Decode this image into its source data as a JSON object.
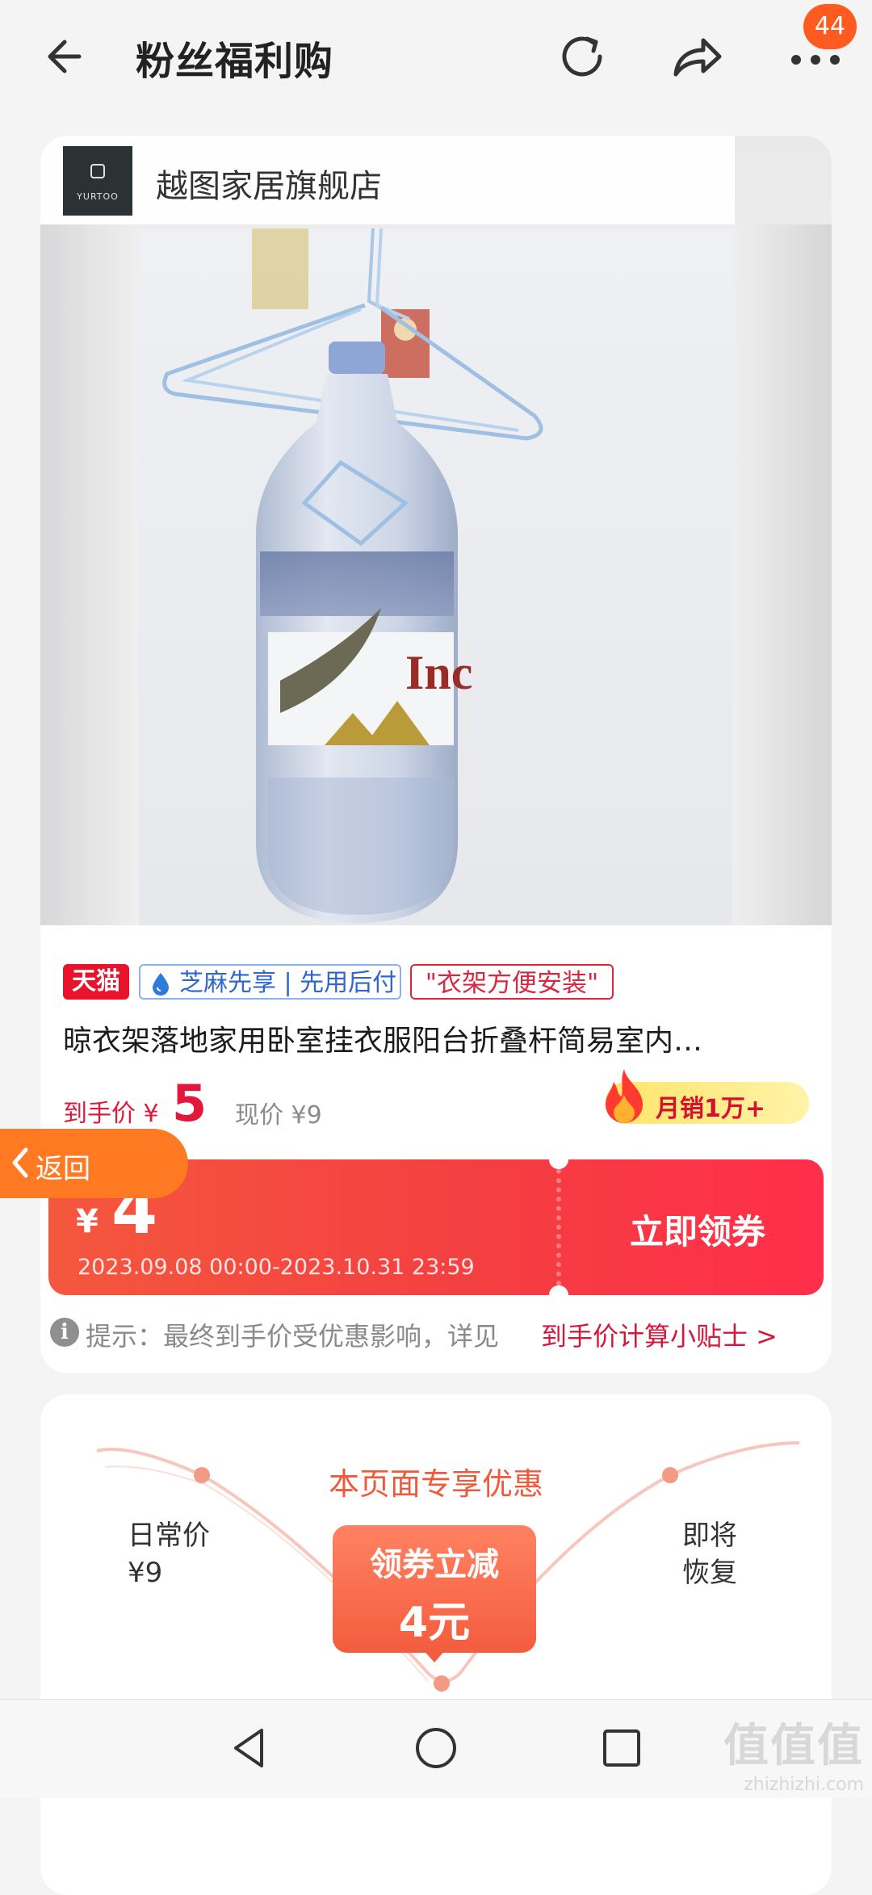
{
  "header": {
    "title": "粉丝福利购",
    "notification_count": "44",
    "icons": [
      "back-arrow-icon",
      "refresh-icon",
      "share-icon",
      "more-dots-icon"
    ]
  },
  "store": {
    "name": "越图家居旗舰店",
    "logo_text": "YURTOO"
  },
  "product": {
    "tags": {
      "tmall": "天猫",
      "zhima": "芝麻先享 | 先用后付",
      "feature": "\"衣架方便安装\""
    },
    "title": "晾衣架落地家用卧室挂衣服阳台折叠杆简易室内…",
    "price_label": "到手价 ¥",
    "price_value": "5",
    "current_price": "现价 ¥9",
    "monthly_sales": "月销1万+"
  },
  "coupon": {
    "currency": "¥",
    "amount": "4",
    "period": "2023.09.08 00:00-2023.10.31 23:59",
    "cta": "立即领券"
  },
  "tip": {
    "text": "提示：最终到手价受优惠影响，详见",
    "link": "到手价计算小贴士 >"
  },
  "float_back": {
    "label": "返回"
  },
  "promo": {
    "heading": "本页面专享优惠",
    "daily_label": "日常价",
    "daily_price": "¥9",
    "restore_line1": "即将",
    "restore_line2": "恢复",
    "bubble_line1": "领券立减",
    "bubble_line2": "4元"
  },
  "watermark": {
    "brand": "值值值",
    "url": "zhizhizhi.com"
  },
  "colors": {
    "accent_red": "#e3163b",
    "coupon_orange": "#f5573e",
    "back_pill": "#ff7a22",
    "badge": "#ff5a1f"
  }
}
